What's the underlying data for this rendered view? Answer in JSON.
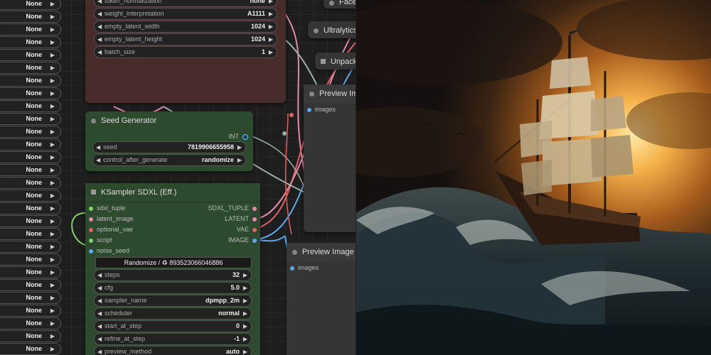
{
  "left_column": {
    "value": "None",
    "rows": [
      "None",
      "None",
      "None",
      "None",
      "None",
      "None",
      "None",
      "None",
      "None",
      "None",
      "None",
      "None",
      "None",
      "None",
      "None",
      "None",
      "None",
      "None",
      "None",
      "None",
      "None",
      "None",
      "None",
      "None",
      "None",
      "None",
      "None",
      "None"
    ]
  },
  "prompt_node": {
    "widgets": [
      {
        "label": "token_normalization",
        "value": "none"
      },
      {
        "label": "weight_interpretation",
        "value": "A1111"
      },
      {
        "label": "empty_latent_width",
        "value": "1024"
      },
      {
        "label": "empty_latent_height",
        "value": "1024"
      },
      {
        "label": "batch_size",
        "value": "1"
      }
    ]
  },
  "seed_node": {
    "title": "Seed Generator",
    "output": "INT",
    "widgets": [
      {
        "label": "seed",
        "value": "7819906655958"
      },
      {
        "label": "control_after_generate",
        "value": "randomize"
      }
    ]
  },
  "ksampler": {
    "title": "KSampler SDXL (Eff.)",
    "inputs": [
      "sdxl_tuple",
      "latent_image",
      "optional_vae",
      "script",
      "noise_seed"
    ],
    "outputs": [
      "SDXL_TUPLE",
      "LATENT",
      "VAE",
      "IMAGE"
    ],
    "seed_button": "Randomize / ♻ 893523066046886",
    "widgets": [
      {
        "label": "steps",
        "value": "32"
      },
      {
        "label": "cfg",
        "value": "5.0"
      },
      {
        "label": "sampler_name",
        "value": "dpmpp_2m"
      },
      {
        "label": "scheduler",
        "value": "normal"
      },
      {
        "label": "start_at_step",
        "value": "0"
      },
      {
        "label": "refine_at_step",
        "value": "-1"
      },
      {
        "label": "preview_method",
        "value": "auto"
      }
    ]
  },
  "side_nodes": {
    "face_title": "Face",
    "ultralytics_title": "Ultralytics",
    "unpack_title": "Unpack",
    "preview1_title": "Preview Im",
    "preview1_input": "images",
    "preview2_title": "Preview Image",
    "preview2_input": "images"
  },
  "colors": {
    "link_pink": "#e28aa7",
    "link_blue": "#5fa8e8",
    "link_green": "#80d06a",
    "link_red": "#e06060",
    "node_green": "#2d4a2e",
    "node_red": "#4a2b2b"
  }
}
